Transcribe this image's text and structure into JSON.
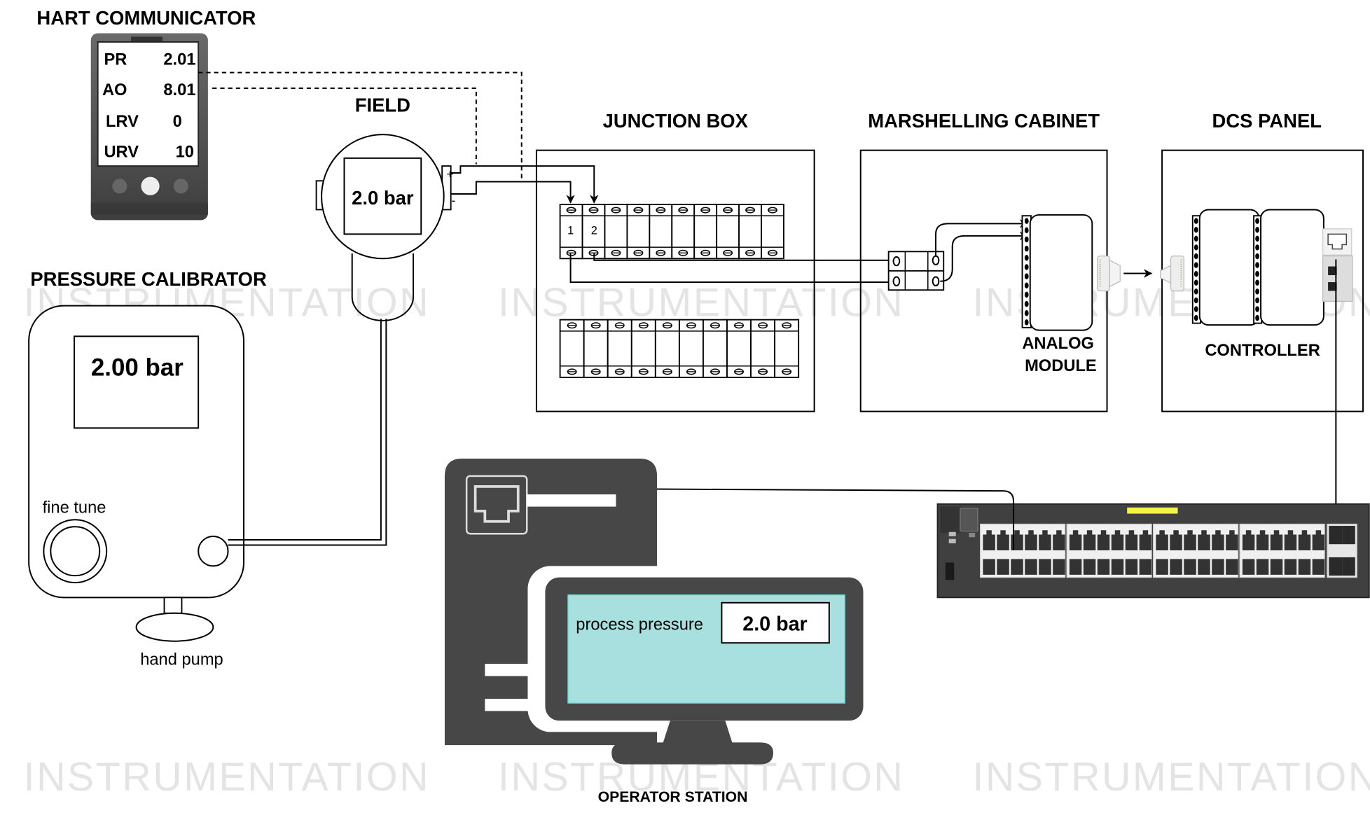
{
  "watermark": "INSTRUMENTATION",
  "hart": {
    "title": "HART COMMUNICATOR",
    "rows": [
      {
        "label": "PR",
        "value": "2.01"
      },
      {
        "label": "AO",
        "value": "8.01"
      },
      {
        "label": "LRV",
        "value": "0"
      },
      {
        "label": "URV",
        "value": "10"
      }
    ]
  },
  "field": {
    "title": "FIELD",
    "display": "2.0 bar",
    "plus": "+",
    "minus": "-"
  },
  "calibrator": {
    "title": "PRESSURE CALIBRATOR",
    "display": "2.00 bar",
    "fine_tune": "fine tune",
    "hand_pump": "hand pump"
  },
  "junction_box": {
    "title": "JUNCTION BOX",
    "terminal_labels": [
      "1",
      "2"
    ]
  },
  "marshalling": {
    "title": "MARSHELLING CABINET",
    "module_label_1": "ANALOG",
    "module_label_2": "MODULE"
  },
  "dcs": {
    "title": "DCS PANEL",
    "controller_label": "CONTROLLER"
  },
  "operator": {
    "title": "OPERATOR STATION",
    "screen_label": "process pressure",
    "screen_value": "2.0 bar"
  },
  "colors": {
    "device_dark": "#474747",
    "screen_cyan": "#a8e0e0",
    "switch_led": "#f4f442",
    "switch_body": "#404040"
  }
}
